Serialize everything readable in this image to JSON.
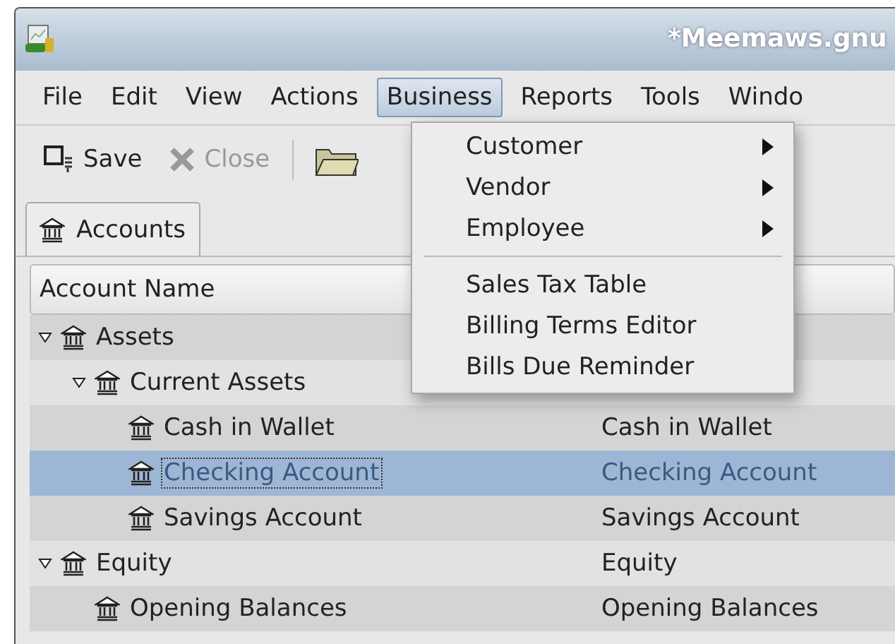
{
  "window": {
    "title": "*Meemaws.gnu"
  },
  "menubar": [
    {
      "label": "File",
      "selected": false
    },
    {
      "label": "Edit",
      "selected": false
    },
    {
      "label": "View",
      "selected": false
    },
    {
      "label": "Actions",
      "selected": false
    },
    {
      "label": "Business",
      "selected": true
    },
    {
      "label": "Reports",
      "selected": false
    },
    {
      "label": "Tools",
      "selected": false
    },
    {
      "label": "Windo",
      "selected": false
    }
  ],
  "toolbar": [
    {
      "label": "Save",
      "disabled": false
    },
    {
      "label": "Close",
      "disabled": true
    }
  ],
  "tabs": [
    {
      "label": "Accounts",
      "selected": true
    }
  ],
  "table": {
    "columns": [
      "Account Name"
    ],
    "rows": [
      {
        "name": "Assets",
        "expanded": true,
        "selected": false,
        "children": [
          {
            "name": "Current Assets",
            "expanded": true,
            "selected": false,
            "children": [
              {
                "name": "Cash in Wallet",
                "column_2": "Cash in Wallet",
                "selected": false
              },
              {
                "name": "Checking Account",
                "column_2": "Checking Account",
                "selected": true
              },
              {
                "name": "Savings Account",
                "column_2": "Savings Account",
                "selected": false
              }
            ]
          }
        ]
      },
      {
        "name": "Equity",
        "column_2": "Equity",
        "expanded": true,
        "selected": false,
        "children": [
          {
            "name": "Opening Balances",
            "column_2": "Opening Balances",
            "selected": false
          }
        ]
      }
    ]
  },
  "business_menu": [
    {
      "kind": "submenu",
      "label": "Customer"
    },
    {
      "kind": "submenu",
      "label": "Vendor"
    },
    {
      "kind": "submenu",
      "label": "Employee"
    },
    {
      "kind": "separator"
    },
    {
      "kind": "item",
      "label": "Sales Tax Table"
    },
    {
      "kind": "item",
      "label": "Billing Terms Editor"
    },
    {
      "kind": "item",
      "label": "Bills Due Reminder"
    }
  ]
}
